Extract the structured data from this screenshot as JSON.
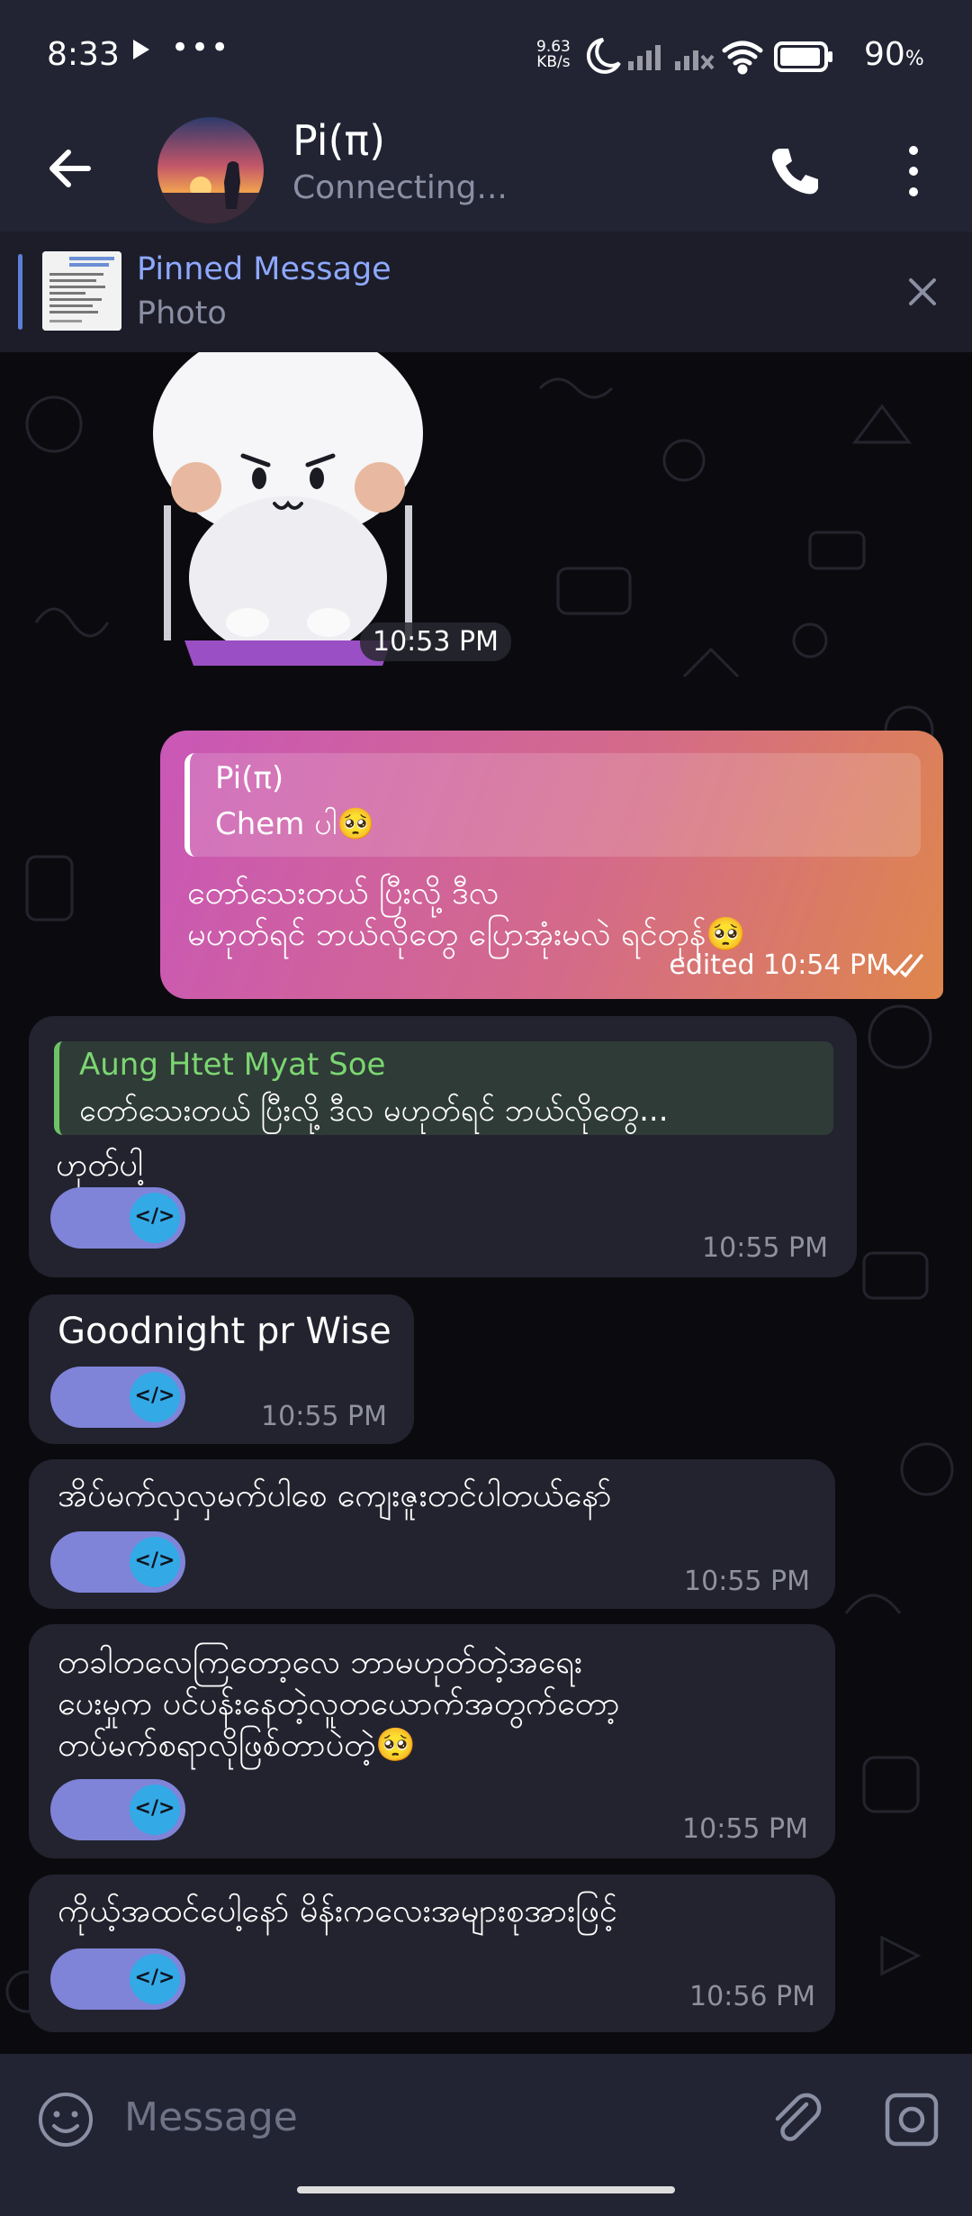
{
  "status": {
    "time": "8:33",
    "dots": "•••",
    "speed_top": "9.63",
    "speed_bottom": "KB/s",
    "battery": "90",
    "battery_unit": "%"
  },
  "header": {
    "title": "Pi(π)",
    "subtitle": "Connecting..."
  },
  "pinned": {
    "title": "Pinned Message",
    "subtitle": "Photo"
  },
  "messages": {
    "sticker_time": "10:53 PM",
    "out": {
      "quote_name": "Pi(π)",
      "quote_text": "Chem ပါ🥺",
      "text": "တော်သေးတယ် ပြီးလို့ ဒီလ\nမဟုတ်ရင် ဘယ်လိုတွေ ပြောအုံးမလဲ ရင်တုန်🥺",
      "time": "edited 10:54 PM"
    },
    "m1": {
      "quote_name": "Aung Htet Myat Soe",
      "quote_text": "တော်သေးတယ် ပြီးလို့ ဒီလ မဟုတ်ရင် ဘယ်လိုတွေ...",
      "text": "ဟုတ်ပါ့",
      "time": "10:55 PM"
    },
    "m2": {
      "text": "Goodnight pr Wise",
      "time": "10:55 PM"
    },
    "m3": {
      "text": "အိပ်မက်လှလှမက်ပါစေ ကျေးဇူးတင်ပါတယ်နော်",
      "time": "10:55 PM"
    },
    "m4": {
      "text": "တခါတလေကြတော့လေ ဘာမဟုတ်တဲ့အရေး\nပေးမှုက ပင်ပန်းနေတဲ့လူတယောက်အတွက်တော့\nတပ်မက်စရာလိုဖြစ်တာပဲတဲ့🥺",
      "time": "10:55 PM"
    },
    "m5": {
      "text": "ကိုယ့်အထင်ပေါ့နော် မိန်းကလေးအများစုအားဖြင့်",
      "time": "10:56 PM"
    }
  },
  "toggle_label": "</>",
  "input": {
    "placeholder": "Message"
  },
  "colors": {
    "header_bg": "#222433",
    "bubble_in": "#23232f",
    "bubble_out_start": "#c957b7",
    "bubble_out_end": "#de864c",
    "accent": "#8ea8ff"
  }
}
